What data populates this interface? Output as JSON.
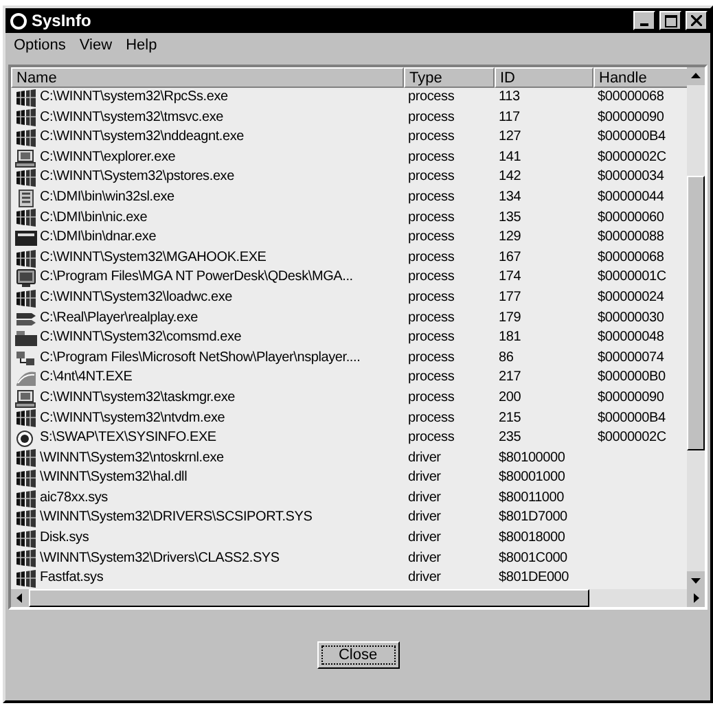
{
  "window": {
    "title": "SysInfo"
  },
  "menu": [
    {
      "label": "Options"
    },
    {
      "label": "View"
    },
    {
      "label": "Help"
    }
  ],
  "table": {
    "columns": [
      "Name",
      "Type",
      "ID",
      "Handle"
    ],
    "rows": [
      {
        "kind": "app",
        "name": "C:\\WINNT\\system32\\RpcSs.exe",
        "type": "process",
        "id": "113",
        "handle": "$00000068"
      },
      {
        "kind": "app",
        "name": "C:\\WINNT\\system32\\tmsvc.exe",
        "type": "process",
        "id": "117",
        "handle": "$00000090"
      },
      {
        "kind": "app",
        "name": "C:\\WINNT\\system32\\nddeagnt.exe",
        "type": "process",
        "id": "127",
        "handle": "$000000B4"
      },
      {
        "kind": "computer",
        "name": "C:\\WINNT\\explorer.exe",
        "type": "process",
        "id": "141",
        "handle": "$0000002C"
      },
      {
        "kind": "app",
        "name": "C:\\WINNT\\System32\\pstores.exe",
        "type": "process",
        "id": "142",
        "handle": "$00000034"
      },
      {
        "kind": "panel",
        "name": "C:\\DMI\\bin\\win32sl.exe",
        "type": "process",
        "id": "134",
        "handle": "$00000044"
      },
      {
        "kind": "app",
        "name": "C:\\DMI\\bin\\nic.exe",
        "type": "process",
        "id": "135",
        "handle": "$00000060"
      },
      {
        "kind": "mark",
        "name": "C:\\DMI\\bin\\dnar.exe",
        "type": "process",
        "id": "129",
        "handle": "$00000088"
      },
      {
        "kind": "app",
        "name": "C:\\WINNT\\System32\\MGAHOOK.EXE",
        "type": "process",
        "id": "167",
        "handle": "$00000068"
      },
      {
        "kind": "monitor",
        "name": "C:\\Program Files\\MGA NT PowerDesk\\QDesk\\MGA...",
        "type": "process",
        "id": "174",
        "handle": "$0000001C"
      },
      {
        "kind": "app",
        "name": "C:\\WINNT\\System32\\loadwc.exe",
        "type": "process",
        "id": "177",
        "handle": "$00000024"
      },
      {
        "kind": "player",
        "name": "C:\\Real\\Player\\realplay.exe",
        "type": "process",
        "id": "179",
        "handle": "$00000030"
      },
      {
        "kind": "device",
        "name": "C:\\WINNT\\System32\\comsmd.exe",
        "type": "process",
        "id": "181",
        "handle": "$00000048"
      },
      {
        "kind": "network",
        "name": "C:\\Program Files\\Microsoft NetShow\\Player\\nsplayer....",
        "type": "process",
        "id": "86",
        "handle": "$00000074"
      },
      {
        "kind": "shell",
        "name": "C:\\4nt\\4NT.EXE",
        "type": "process",
        "id": "217",
        "handle": "$000000B0"
      },
      {
        "kind": "computer",
        "name": "C:\\WINNT\\system32\\taskmgr.exe",
        "type": "process",
        "id": "200",
        "handle": "$00000090"
      },
      {
        "kind": "app",
        "name": "C:\\WINNT\\system32\\ntvdm.exe",
        "type": "process",
        "id": "215",
        "handle": "$000000B4"
      },
      {
        "kind": "target",
        "name": "S:\\SWAP\\TEX\\SYSINFO.EXE",
        "type": "process",
        "id": "235",
        "handle": "$0000002C"
      },
      {
        "kind": "app",
        "name": "\\WINNT\\System32\\ntoskrnl.exe",
        "type": "driver",
        "id": "$80100000"
      },
      {
        "kind": "app",
        "name": "\\WINNT\\System32\\hal.dll",
        "type": "driver",
        "id": "$80001000"
      },
      {
        "kind": "app",
        "name": "aic78xx.sys",
        "type": "driver",
        "id": "$80011000"
      },
      {
        "kind": "app",
        "name": "\\WINNT\\System32\\DRIVERS\\SCSIPORT.SYS",
        "type": "driver",
        "id": "$801D7000"
      },
      {
        "kind": "app",
        "name": "Disk.sys",
        "type": "driver",
        "id": "$80018000"
      },
      {
        "kind": "app",
        "name": "\\WINNT\\System32\\Drivers\\CLASS2.SYS",
        "type": "driver",
        "id": "$8001C000"
      },
      {
        "kind": "app",
        "name": "Fastfat.sys",
        "type": "driver",
        "id": "$801DE000"
      }
    ]
  },
  "buttons": [
    {
      "label": "Close"
    }
  ]
}
